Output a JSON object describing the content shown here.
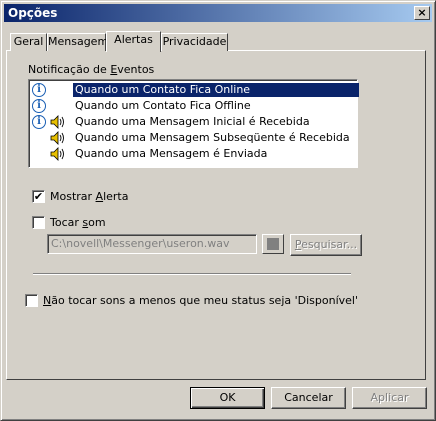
{
  "window": {
    "title": "Opções",
    "close_symbol": "×"
  },
  "tabs": [
    {
      "label": "Geral",
      "active": false
    },
    {
      "label": "Mensagem",
      "active": false
    },
    {
      "label": "Alertas",
      "active": true
    },
    {
      "label": "Privacidade",
      "active": false
    }
  ],
  "events": {
    "group_label_pre": "Notificação de ",
    "group_label_accel": "E",
    "group_label_post": "ventos",
    "items": [
      {
        "label": "Quando um Contato Fica Online",
        "icons": [
          "info-icon"
        ],
        "selected": true
      },
      {
        "label": "Quando um Contato Fica Offline",
        "icons": [
          "info-icon"
        ],
        "selected": false
      },
      {
        "label": "Quando uma Mensagem Inicial é Recebida",
        "icons": [
          "info-icon",
          "speaker-icon"
        ],
        "selected": false
      },
      {
        "label": "Quando uma Mensagem Subseqüente é Recebida",
        "icons": [
          "speaker-icon"
        ],
        "selected": false
      },
      {
        "label": "Quando uma Mensagem é Enviada",
        "icons": [
          "speaker-icon"
        ],
        "selected": false
      }
    ]
  },
  "show_alert": {
    "label_pre": "Mostrar ",
    "label_accel": "A",
    "label_post": "lerta",
    "checked": true,
    "check_symbol": "✔"
  },
  "play_sound": {
    "label_pre": "Tocar ",
    "label_accel": "s",
    "label_post": "om",
    "checked": false
  },
  "sound_file": {
    "value": "C:\\novell\\Messenger\\useron.wav"
  },
  "browse_button": {
    "label_accel": "P",
    "label_post": "esquisar..."
  },
  "no_sound": {
    "label_accel": "N",
    "label_post": "ão tocar sons a menos que meu status seja 'Disponível'",
    "checked": false
  },
  "buttons": {
    "ok": "OK",
    "cancel": "Cancelar",
    "apply": "Aplicar"
  },
  "colors": {
    "selection": "#0a246a",
    "title_start": "#0a246a",
    "title_end": "#a6caf0",
    "face": "#d4d0c8"
  }
}
